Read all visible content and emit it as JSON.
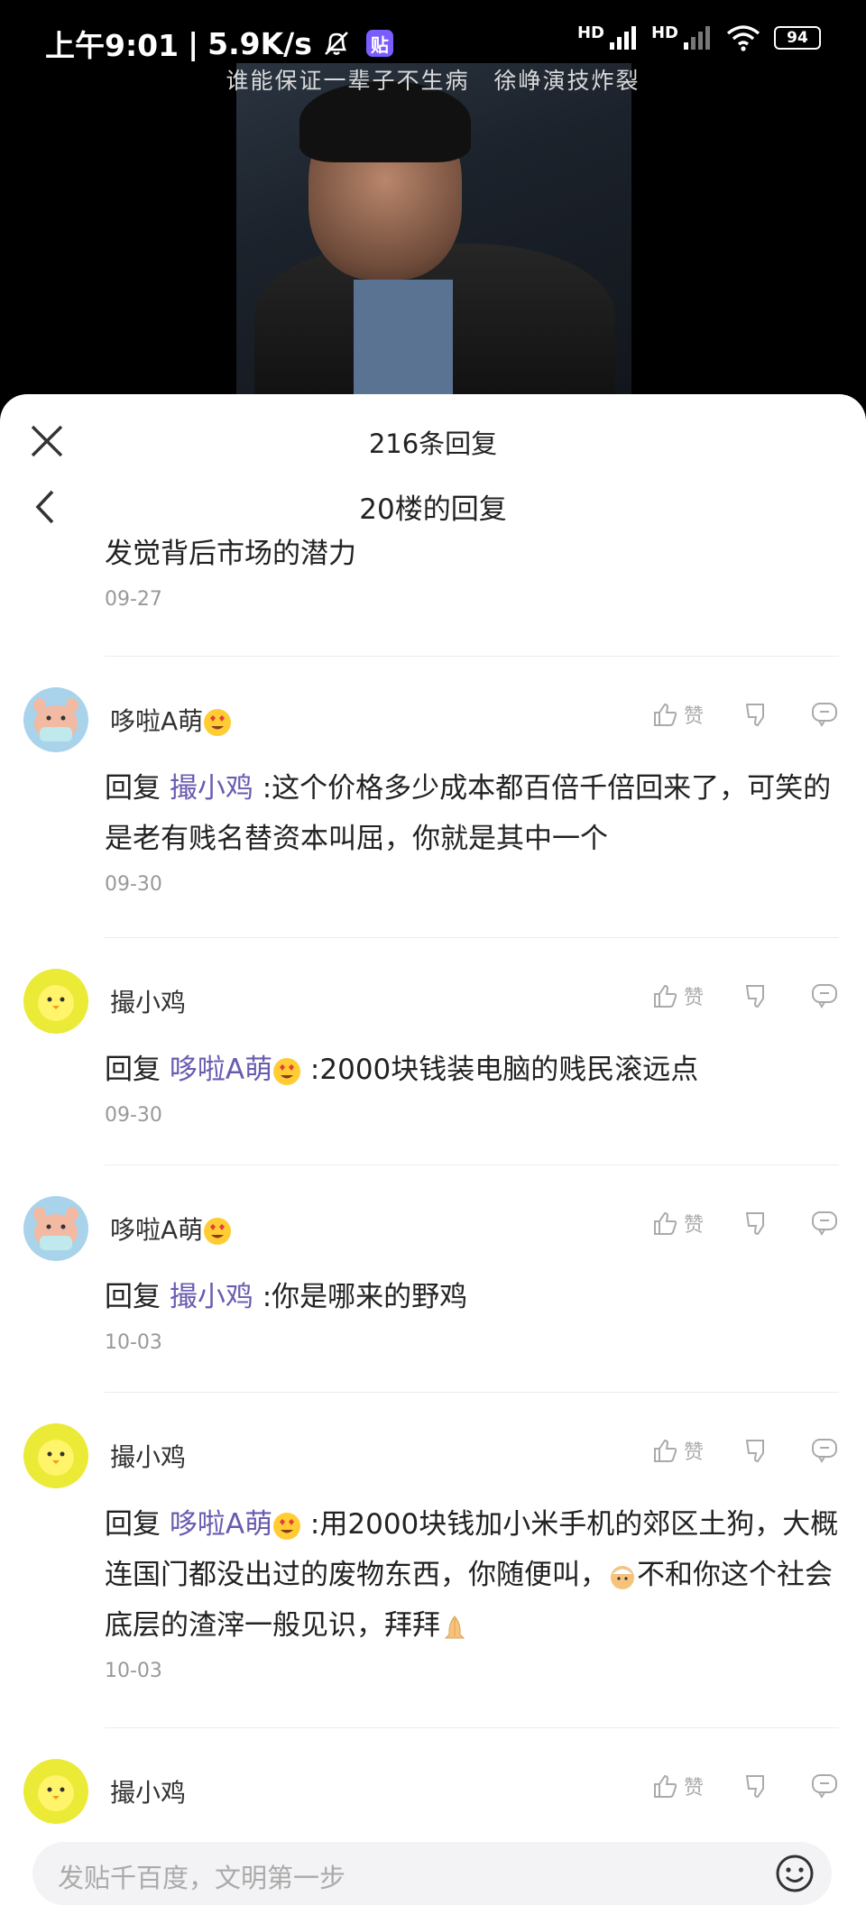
{
  "status_bar": {
    "time": "上午9:01",
    "separator": "|",
    "net_speed": "5.9K/s",
    "app_badge": "贴",
    "hd1": "HD",
    "hd2": "HD",
    "battery": "94"
  },
  "video": {
    "subtitle": "谁能保证一辈子不生病　徐峥演技炸裂"
  },
  "sheet": {
    "title": "216条回复",
    "subtitle": "20楼的回复"
  },
  "first_reply": {
    "text": "发觉背后市场的潜力",
    "date": "09-27"
  },
  "labels": {
    "like": "赞",
    "reply_prefix": "回复"
  },
  "comments": [
    {
      "user": "哆啦A萌",
      "avatar": "pig-avatar",
      "mention": "撮小鸡",
      "text": " :这个价格多少成本都百倍千倍回来了，可笑的是老有贱名替资本叫屈，你就是其中一个",
      "date": "09-30"
    },
    {
      "user": "撮小鸡",
      "avatar": "chick-avatar",
      "mention": "哆啦A萌",
      "text": " :2000块钱装电脑的贱民滚远点",
      "date": "09-30"
    },
    {
      "user": "哆啦A萌",
      "avatar": "pig-avatar",
      "mention": "撮小鸡",
      "text": " :你是哪来的野鸡",
      "date": "10-03"
    },
    {
      "user": "撮小鸡",
      "avatar": "chick-avatar",
      "mention": "哆啦A萌",
      "text_a": " :用2000块钱加小米手机的郊区土狗，大概连国门都没出过的废物东西，你随便叫，",
      "text_b": "不和你这个社会底层的渣滓一般见识，拜拜",
      "date": "10-03"
    },
    {
      "user": "撮小鸡",
      "avatar": "chick-avatar"
    }
  ],
  "input": {
    "placeholder": "发贴千百度，文明第一步"
  },
  "colors": {
    "mention": "#6b5bb0",
    "date": "#999999",
    "sheet_bg": "#ffffff"
  }
}
